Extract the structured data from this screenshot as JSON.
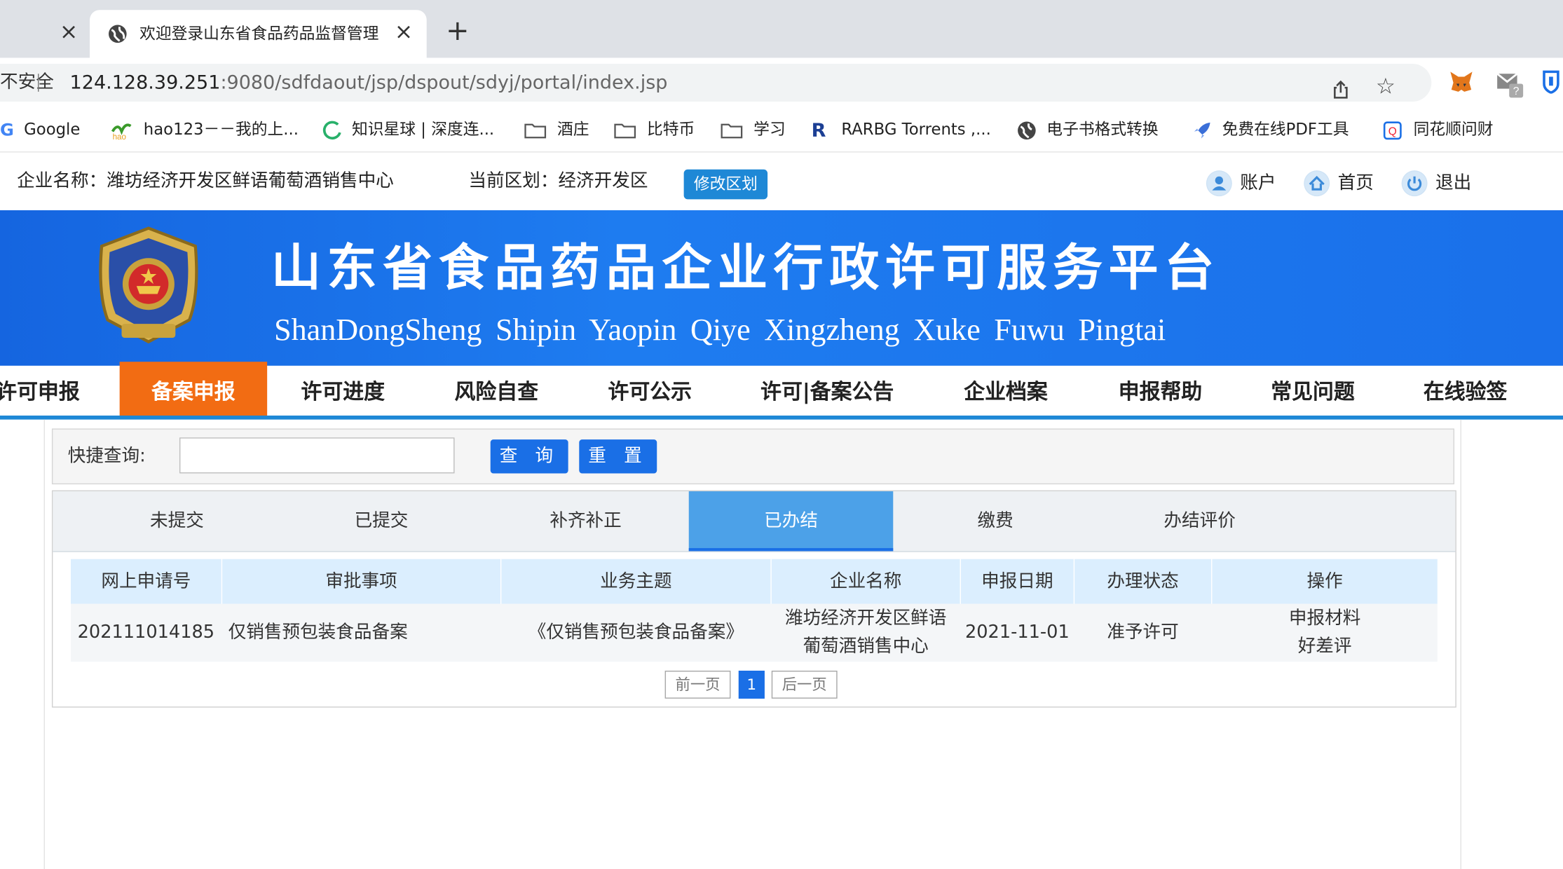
{
  "browser": {
    "tab_title": "欢迎登录山东省食品药品监督管理",
    "insecure_label": "不安全",
    "url_host": "124.128.39.251",
    "url_rest": ":9080/sdfdaout/jsp/dspout/sdyj/portal/index.jsp",
    "bookmarks": [
      {
        "label": "Google",
        "icon": "google-icon"
      },
      {
        "label": "hao123－－我的上...",
        "icon": "hao123-icon"
      },
      {
        "label": "知识星球 | 深度连...",
        "icon": "zsxq-icon"
      },
      {
        "label": "酒庄",
        "icon": "folder-icon"
      },
      {
        "label": "比特币",
        "icon": "folder-icon"
      },
      {
        "label": "学习",
        "icon": "folder-icon"
      },
      {
        "label": "RARBG Torrents ,...",
        "icon": "rarbg-icon"
      },
      {
        "label": "电子书格式转换",
        "icon": "globe-icon"
      },
      {
        "label": "免费在线PDF工具",
        "icon": "rocket-icon"
      },
      {
        "label": "同花顺问财",
        "icon": "ths-icon"
      }
    ]
  },
  "header": {
    "company": "企业名称：潍坊经济开发区鲜语葡萄酒销售中心",
    "region": "当前区划：经济开发区",
    "modify_region": "修改区划",
    "account": "账户",
    "home": "首页",
    "logout": "退出"
  },
  "banner": {
    "title": "山东省食品药品企业行政许可服务平台",
    "subtitle": "ShanDongSheng Shipin Yaopin Qiye Xingzheng Xuke Fuwu Pingtai"
  },
  "nav": {
    "items": [
      "许可申报",
      "备案申报",
      "许可进度",
      "风险自查",
      "许可公示",
      "许可|备案公告",
      "企业档案",
      "申报帮助",
      "常见问题",
      "在线验签"
    ],
    "active": "备案申报"
  },
  "search": {
    "label": "快捷查询:",
    "value": "",
    "query_button": "查 询",
    "reset_button": "重 置"
  },
  "subtabs": {
    "items": [
      "未提交",
      "已提交",
      "补齐补正",
      "已办结",
      "缴费",
      "办结评价"
    ],
    "active": "已办结"
  },
  "table": {
    "columns": [
      "网上申请号",
      "审批事项",
      "业务主题",
      "企业名称",
      "申报日期",
      "办理状态",
      "操作"
    ],
    "rows": [
      {
        "apply_no": "202111014185",
        "item": "仅销售预包装食品备案",
        "topic": "《仅销售预包装食品备案》",
        "company_line1": "潍坊经济开发区鲜语",
        "company_line2": "葡萄酒销售中心",
        "date": "2021-11-01",
        "status": "准予许可",
        "action1": "申报材料",
        "action2": "好差评"
      }
    ]
  },
  "pager": {
    "prev": "前一页",
    "current": "1",
    "next": "后一页"
  },
  "colors": {
    "banner_blue": "#1a6fe6",
    "nav_active_orange": "#f26c13",
    "accent_blue": "#1e88d6",
    "table_header": "#dbeefe"
  }
}
